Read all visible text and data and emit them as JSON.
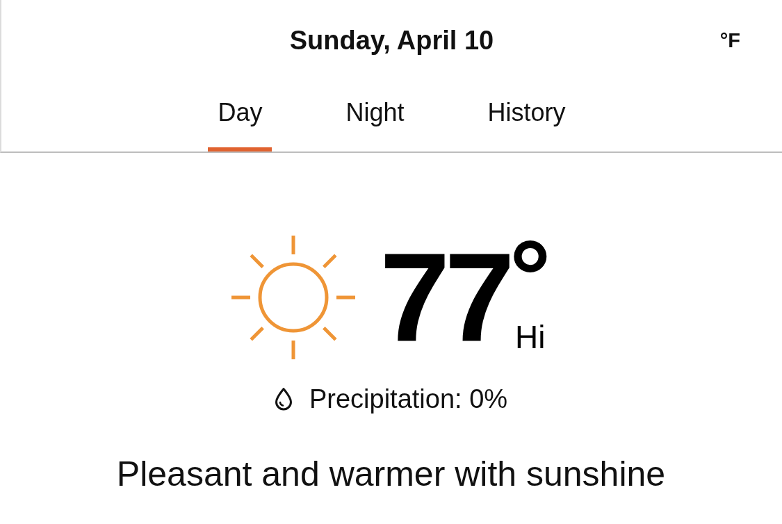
{
  "header": {
    "date": "Sunday, April 10",
    "unit": "°F"
  },
  "tabs": [
    {
      "label": "Day",
      "selected": true
    },
    {
      "label": "Night",
      "selected": false
    },
    {
      "label": "History",
      "selected": false
    }
  ],
  "forecast": {
    "temperature": "77",
    "degree": "°",
    "label": "Hi",
    "precipitation": "Precipitation: 0%",
    "summary": "Pleasant and warmer with sunshine"
  }
}
